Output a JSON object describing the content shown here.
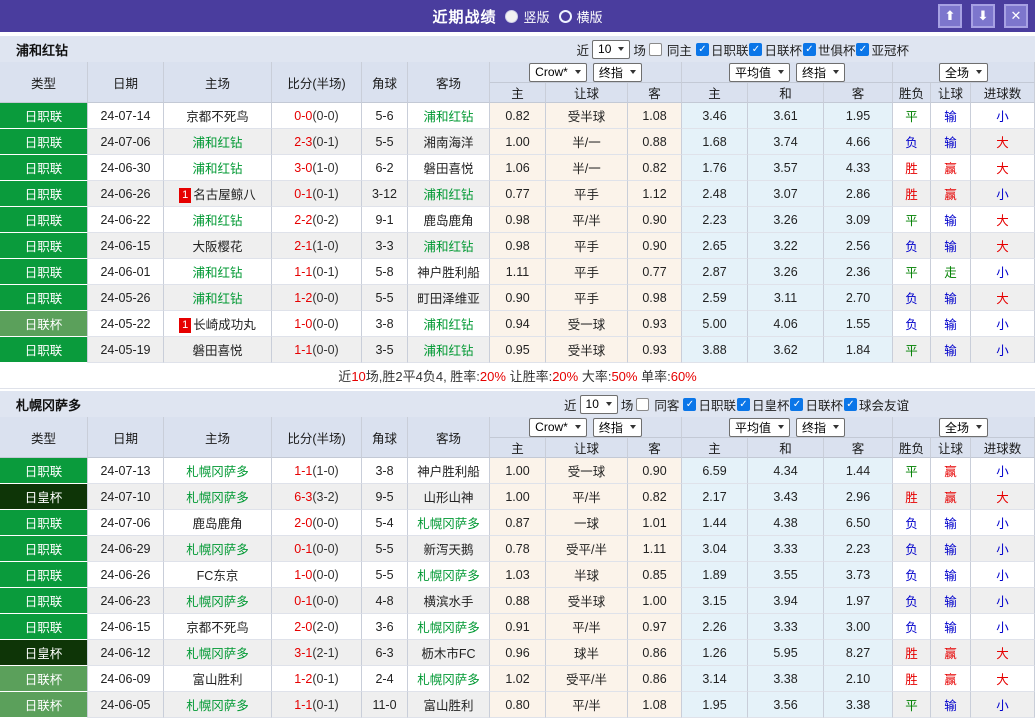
{
  "titlebar": {
    "title": "近期战绩",
    "radio_vertical": "竖版",
    "radio_horizontal": "横版"
  },
  "icons": {
    "up": "⬆",
    "down": "⬇",
    "close": "✕",
    "check": "✓"
  },
  "colors": {
    "titlebar_bg": "#4a3d9e",
    "titlebar_button_bg": "#7d76cd",
    "titlebar_button_border": "#a7a1e3",
    "panel_bg": "#dfe5f1",
    "header_bg": "#dae1ef",
    "league_j1": "#0a9b3c",
    "league_cup": "#5ba05b",
    "league_emperor": "#0e3507",
    "subject_team": "#009933",
    "win_red": "#e60000",
    "draw_green": "#008000",
    "lose_blue": "#0000cc",
    "odds_bg": "#fbf3ea",
    "avg_bg": "#e5f2f9"
  },
  "columns": {
    "type": "类型",
    "date": "日期",
    "home": "主场",
    "score": "比分(半场)",
    "corner": "角球",
    "away": "客场",
    "sub": [
      "主",
      "让球",
      "客",
      "主",
      "和",
      "客",
      "胜负",
      "让球",
      "进球数"
    ],
    "selects": {
      "provider": "Crow*",
      "final1": "终指",
      "average": "平均值",
      "final2": "终指",
      "fulltime": "全场"
    }
  },
  "sections": [
    {
      "team": "浦和红钻",
      "filter": {
        "near": "近",
        "count": "10",
        "games": "场",
        "venue": "同主",
        "leagues": [
          "日职联",
          "日联杯",
          "世俱杯",
          "亚冠杯"
        ]
      },
      "rows": [
        {
          "league": "日职联",
          "league_type": "j1",
          "date": "24-07-14",
          "home": "京都不死鸟",
          "home_subject": false,
          "home_badge": null,
          "score_full": "0-0",
          "score_half": "(0-0)",
          "corners": "5-6",
          "away": "浦和红钻",
          "away_subject": true,
          "odds_home": "0.82",
          "handicap": "受半球",
          "odds_away": "1.08",
          "avg_home": "3.46",
          "avg_draw": "3.61",
          "avg_away": "1.95",
          "result": "平",
          "handicap_result": "输",
          "goals": "小"
        },
        {
          "league": "日职联",
          "league_type": "j1",
          "date": "24-07-06",
          "home": "浦和红钻",
          "home_subject": true,
          "home_badge": null,
          "score_full": "2-3",
          "score_half": "(0-1)",
          "corners": "5-5",
          "away": "湘南海洋",
          "away_subject": false,
          "odds_home": "1.00",
          "handicap": "半/一",
          "odds_away": "0.88",
          "avg_home": "1.68",
          "avg_draw": "3.74",
          "avg_away": "4.66",
          "result": "负",
          "handicap_result": "输",
          "goals": "大"
        },
        {
          "league": "日职联",
          "league_type": "j1",
          "date": "24-06-30",
          "home": "浦和红钻",
          "home_subject": true,
          "home_badge": null,
          "score_full": "3-0",
          "score_half": "(1-0)",
          "corners": "6-2",
          "away": "磐田喜悦",
          "away_subject": false,
          "odds_home": "1.06",
          "handicap": "半/一",
          "odds_away": "0.82",
          "avg_home": "1.76",
          "avg_draw": "3.57",
          "avg_away": "4.33",
          "result": "胜",
          "handicap_result": "赢",
          "goals": "大"
        },
        {
          "league": "日职联",
          "league_type": "j1",
          "date": "24-06-26",
          "home": "名古屋鲸八",
          "home_subject": false,
          "home_badge": "1",
          "score_full": "0-1",
          "score_half": "(0-1)",
          "corners": "3-12",
          "away": "浦和红钻",
          "away_subject": true,
          "odds_home": "0.77",
          "handicap": "平手",
          "odds_away": "1.12",
          "avg_home": "2.48",
          "avg_draw": "3.07",
          "avg_away": "2.86",
          "result": "胜",
          "handicap_result": "赢",
          "goals": "小"
        },
        {
          "league": "日职联",
          "league_type": "j1",
          "date": "24-06-22",
          "home": "浦和红钻",
          "home_subject": true,
          "home_badge": null,
          "score_full": "2-2",
          "score_half": "(0-2)",
          "corners": "9-1",
          "away": "鹿岛鹿角",
          "away_subject": false,
          "odds_home": "0.98",
          "handicap": "平/半",
          "odds_away": "0.90",
          "avg_home": "2.23",
          "avg_draw": "3.26",
          "avg_away": "3.09",
          "result": "平",
          "handicap_result": "输",
          "goals": "大"
        },
        {
          "league": "日职联",
          "league_type": "j1",
          "date": "24-06-15",
          "home": "大阪樱花",
          "home_subject": false,
          "home_badge": null,
          "score_full": "2-1",
          "score_half": "(1-0)",
          "corners": "3-3",
          "away": "浦和红钻",
          "away_subject": true,
          "odds_home": "0.98",
          "handicap": "平手",
          "odds_away": "0.90",
          "avg_home": "2.65",
          "avg_draw": "3.22",
          "avg_away": "2.56",
          "result": "负",
          "handicap_result": "输",
          "goals": "大"
        },
        {
          "league": "日职联",
          "league_type": "j1",
          "date": "24-06-01",
          "home": "浦和红钻",
          "home_subject": true,
          "home_badge": null,
          "score_full": "1-1",
          "score_half": "(0-1)",
          "corners": "5-8",
          "away": "神户胜利船",
          "away_subject": false,
          "odds_home": "1.11",
          "handicap": "平手",
          "odds_away": "0.77",
          "avg_home": "2.87",
          "avg_draw": "3.26",
          "avg_away": "2.36",
          "result": "平",
          "handicap_result": "走",
          "goals": "小"
        },
        {
          "league": "日职联",
          "league_type": "j1",
          "date": "24-05-26",
          "home": "浦和红钻",
          "home_subject": true,
          "home_badge": null,
          "score_full": "1-2",
          "score_half": "(0-0)",
          "corners": "5-5",
          "away": "町田泽维亚",
          "away_subject": false,
          "odds_home": "0.90",
          "handicap": "平手",
          "odds_away": "0.98",
          "avg_home": "2.59",
          "avg_draw": "3.11",
          "avg_away": "2.70",
          "result": "负",
          "handicap_result": "输",
          "goals": "大"
        },
        {
          "league": "日联杯",
          "league_type": "cup",
          "date": "24-05-22",
          "home": "长崎成功丸",
          "home_subject": false,
          "home_badge": "1",
          "score_full": "1-0",
          "score_half": "(0-0)",
          "corners": "3-8",
          "away": "浦和红钻",
          "away_subject": true,
          "odds_home": "0.94",
          "handicap": "受一球",
          "odds_away": "0.93",
          "avg_home": "5.00",
          "avg_draw": "4.06",
          "avg_away": "1.55",
          "result": "负",
          "handicap_result": "输",
          "goals": "小"
        },
        {
          "league": "日职联",
          "league_type": "j1",
          "date": "24-05-19",
          "home": "磐田喜悦",
          "home_subject": false,
          "home_badge": null,
          "score_full": "1-1",
          "score_half": "(0-0)",
          "corners": "3-5",
          "away": "浦和红钻",
          "away_subject": true,
          "odds_home": "0.95",
          "handicap": "受半球",
          "odds_away": "0.93",
          "avg_home": "3.88",
          "avg_draw": "3.62",
          "avg_away": "1.84",
          "result": "平",
          "handicap_result": "输",
          "goals": "小"
        }
      ],
      "summary": [
        {
          "text": "近"
        },
        {
          "text": "10",
          "red": true
        },
        {
          "text": "场,胜2平4负4, 胜率:"
        },
        {
          "text": "20%",
          "red": true
        },
        {
          "text": " 让胜率:"
        },
        {
          "text": "20%",
          "red": true
        },
        {
          "text": " 大率:"
        },
        {
          "text": "50%",
          "red": true
        },
        {
          "text": " 单率:"
        },
        {
          "text": "60%",
          "red": true
        }
      ]
    },
    {
      "team": "札幌冈萨多",
      "filter": {
        "near": "近",
        "count": "10",
        "games": "场",
        "venue": "同客",
        "leagues": [
          "日职联",
          "日皇杯",
          "日联杯",
          "球会友谊"
        ]
      },
      "rows": [
        {
          "league": "日职联",
          "league_type": "j1",
          "date": "24-07-13",
          "home": "札幌冈萨多",
          "home_subject": true,
          "home_badge": null,
          "score_full": "1-1",
          "score_half": "(1-0)",
          "corners": "3-8",
          "away": "神户胜利船",
          "away_subject": false,
          "odds_home": "1.00",
          "handicap": "受一球",
          "odds_away": "0.90",
          "avg_home": "6.59",
          "avg_draw": "4.34",
          "avg_away": "1.44",
          "result": "平",
          "handicap_result": "赢",
          "goals": "小"
        },
        {
          "league": "日皇杯",
          "league_type": "emperor",
          "date": "24-07-10",
          "home": "札幌冈萨多",
          "home_subject": true,
          "home_badge": null,
          "score_full": "6-3",
          "score_half": "(3-2)",
          "corners": "9-5",
          "away": "山形山神",
          "away_subject": false,
          "odds_home": "1.00",
          "handicap": "平/半",
          "odds_away": "0.82",
          "avg_home": "2.17",
          "avg_draw": "3.43",
          "avg_away": "2.96",
          "result": "胜",
          "handicap_result": "赢",
          "goals": "大"
        },
        {
          "league": "日职联",
          "league_type": "j1",
          "date": "24-07-06",
          "home": "鹿岛鹿角",
          "home_subject": false,
          "home_badge": null,
          "score_full": "2-0",
          "score_half": "(0-0)",
          "corners": "5-4",
          "away": "札幌冈萨多",
          "away_subject": true,
          "odds_home": "0.87",
          "handicap": "一球",
          "odds_away": "1.01",
          "avg_home": "1.44",
          "avg_draw": "4.38",
          "avg_away": "6.50",
          "result": "负",
          "handicap_result": "输",
          "goals": "小"
        },
        {
          "league": "日职联",
          "league_type": "j1",
          "date": "24-06-29",
          "home": "札幌冈萨多",
          "home_subject": true,
          "home_badge": null,
          "score_full": "0-1",
          "score_half": "(0-0)",
          "corners": "5-5",
          "away": "新泻天鹅",
          "away_subject": false,
          "odds_home": "0.78",
          "handicap": "受平/半",
          "odds_away": "1.11",
          "avg_home": "3.04",
          "avg_draw": "3.33",
          "avg_away": "2.23",
          "result": "负",
          "handicap_result": "输",
          "goals": "小"
        },
        {
          "league": "日职联",
          "league_type": "j1",
          "date": "24-06-26",
          "home": "FC东京",
          "home_subject": false,
          "home_badge": null,
          "score_full": "1-0",
          "score_half": "(0-0)",
          "corners": "5-5",
          "away": "札幌冈萨多",
          "away_subject": true,
          "odds_home": "1.03",
          "handicap": "半球",
          "odds_away": "0.85",
          "avg_home": "1.89",
          "avg_draw": "3.55",
          "avg_away": "3.73",
          "result": "负",
          "handicap_result": "输",
          "goals": "小"
        },
        {
          "league": "日职联",
          "league_type": "j1",
          "date": "24-06-23",
          "home": "札幌冈萨多",
          "home_subject": true,
          "home_badge": null,
          "score_full": "0-1",
          "score_half": "(0-0)",
          "corners": "4-8",
          "away": "横滨水手",
          "away_subject": false,
          "odds_home": "0.88",
          "handicap": "受半球",
          "odds_away": "1.00",
          "avg_home": "3.15",
          "avg_draw": "3.94",
          "avg_away": "1.97",
          "result": "负",
          "handicap_result": "输",
          "goals": "小"
        },
        {
          "league": "日职联",
          "league_type": "j1",
          "date": "24-06-15",
          "home": "京都不死鸟",
          "home_subject": false,
          "home_badge": null,
          "score_full": "2-0",
          "score_half": "(2-0)",
          "corners": "3-6",
          "away": "札幌冈萨多",
          "away_subject": true,
          "odds_home": "0.91",
          "handicap": "平/半",
          "odds_away": "0.97",
          "avg_home": "2.26",
          "avg_draw": "3.33",
          "avg_away": "3.00",
          "result": "负",
          "handicap_result": "输",
          "goals": "小"
        },
        {
          "league": "日皇杯",
          "league_type": "emperor",
          "date": "24-06-12",
          "home": "札幌冈萨多",
          "home_subject": true,
          "home_badge": null,
          "score_full": "3-1",
          "score_half": "(2-1)",
          "corners": "6-3",
          "away": "枥木市FC",
          "away_subject": false,
          "odds_home": "0.96",
          "handicap": "球半",
          "odds_away": "0.86",
          "avg_home": "1.26",
          "avg_draw": "5.95",
          "avg_away": "8.27",
          "result": "胜",
          "handicap_result": "赢",
          "goals": "大"
        },
        {
          "league": "日联杯",
          "league_type": "cup",
          "date": "24-06-09",
          "home": "富山胜利",
          "home_subject": false,
          "home_badge": null,
          "score_full": "1-2",
          "score_half": "(0-1)",
          "corners": "2-4",
          "away": "札幌冈萨多",
          "away_subject": true,
          "odds_home": "1.02",
          "handicap": "受平/半",
          "odds_away": "0.86",
          "avg_home": "3.14",
          "avg_draw": "3.38",
          "avg_away": "2.10",
          "result": "胜",
          "handicap_result": "赢",
          "goals": "大"
        },
        {
          "league": "日联杯",
          "league_type": "cup",
          "date": "24-06-05",
          "home": "札幌冈萨多",
          "home_subject": true,
          "home_badge": null,
          "score_full": "1-1",
          "score_half": "(0-1)",
          "corners": "11-0",
          "away": "富山胜利",
          "away_subject": false,
          "odds_home": "0.80",
          "handicap": "平/半",
          "odds_away": "1.08",
          "avg_home": "1.95",
          "avg_draw": "3.56",
          "avg_away": "3.38",
          "result": "平",
          "handicap_result": "输",
          "goals": "小"
        }
      ],
      "summary": null
    }
  ]
}
